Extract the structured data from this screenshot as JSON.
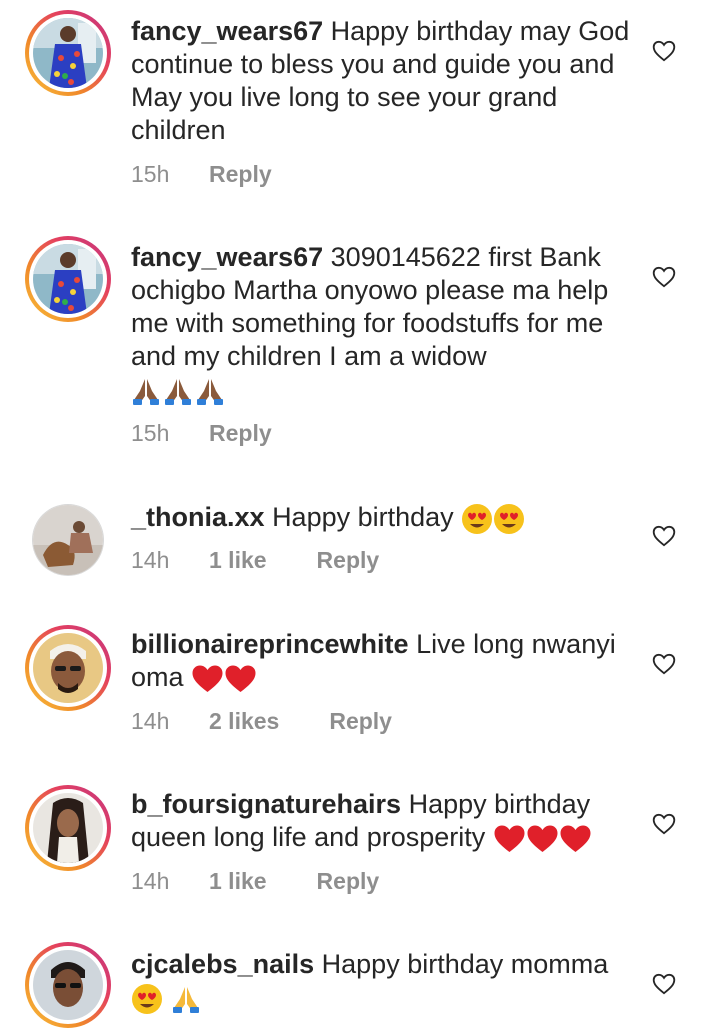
{
  "colors": {
    "text": "#262626",
    "meta": "#8e8e8e",
    "heart": "#e0202a"
  },
  "comments": [
    {
      "username": "fancy_wears67",
      "text": "Happy birthday may God continue to bless you and guide you and May you live long to see your grand children",
      "time": "15h",
      "likes": "",
      "reply": "Reply"
    },
    {
      "username": "fancy_wears67",
      "text": "3090145622 first Bank ochigbo Martha onyowo please ma help me with something for foodstuffs for me and my children I am a widow",
      "time": "15h",
      "likes": "",
      "reply": "Reply"
    },
    {
      "username": "_thonia.xx",
      "text": "Happy birthday",
      "time": "14h",
      "likes": "1 like",
      "reply": "Reply"
    },
    {
      "username": "billionaireprincewhite",
      "text": "Live long nwanyi oma",
      "time": "14h",
      "likes": "2 likes",
      "reply": "Reply"
    },
    {
      "username": "b_foursignaturehairs",
      "text": "Happy birthday queen long life and prosperity",
      "time": "14h",
      "likes": "1 like",
      "reply": "Reply"
    },
    {
      "username": "cjcalebs_nails",
      "text": "Happy birthday momma",
      "time": "",
      "likes": "",
      "reply": ""
    }
  ]
}
